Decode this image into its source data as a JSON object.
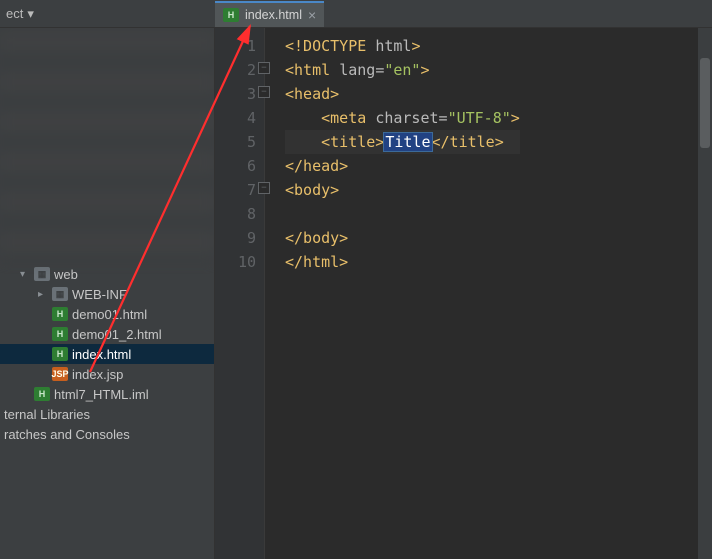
{
  "toolbar": {
    "project_label": "ect"
  },
  "tree": {
    "folder_web": "web",
    "folder_webinf": "WEB-INF",
    "files": {
      "demo01": "demo01.html",
      "demo01_2": "demo01_2.html",
      "index_html": "index.html",
      "index_jsp": "index.jsp",
      "iml": "html7_HTML.iml"
    },
    "ext_lib": "ternal Libraries",
    "scratches": "ratches and Consoles"
  },
  "tab": {
    "label": "index.html"
  },
  "code": {
    "l1a": "<!DOCTYPE ",
    "l1b": "html",
    "l1c": ">",
    "l2a": "<html ",
    "l2b": "lang",
    "l2c": "=",
    "l2d": "\"en\"",
    "l2e": ">",
    "l3": "<head>",
    "l4a": "    <meta ",
    "l4b": "charset",
    "l4c": "=",
    "l4d": "\"UTF-8\"",
    "l4e": ">",
    "l5a": "    <title>",
    "l5sel": "Title",
    "l5b": "</title>",
    "l6": "</head>",
    "l7": "<body>",
    "l8": "",
    "l9": "</body>",
    "l10": "</html>"
  },
  "gutter": [
    "1",
    "2",
    "3",
    "4",
    "5",
    "6",
    "7",
    "8",
    "9",
    "10"
  ]
}
